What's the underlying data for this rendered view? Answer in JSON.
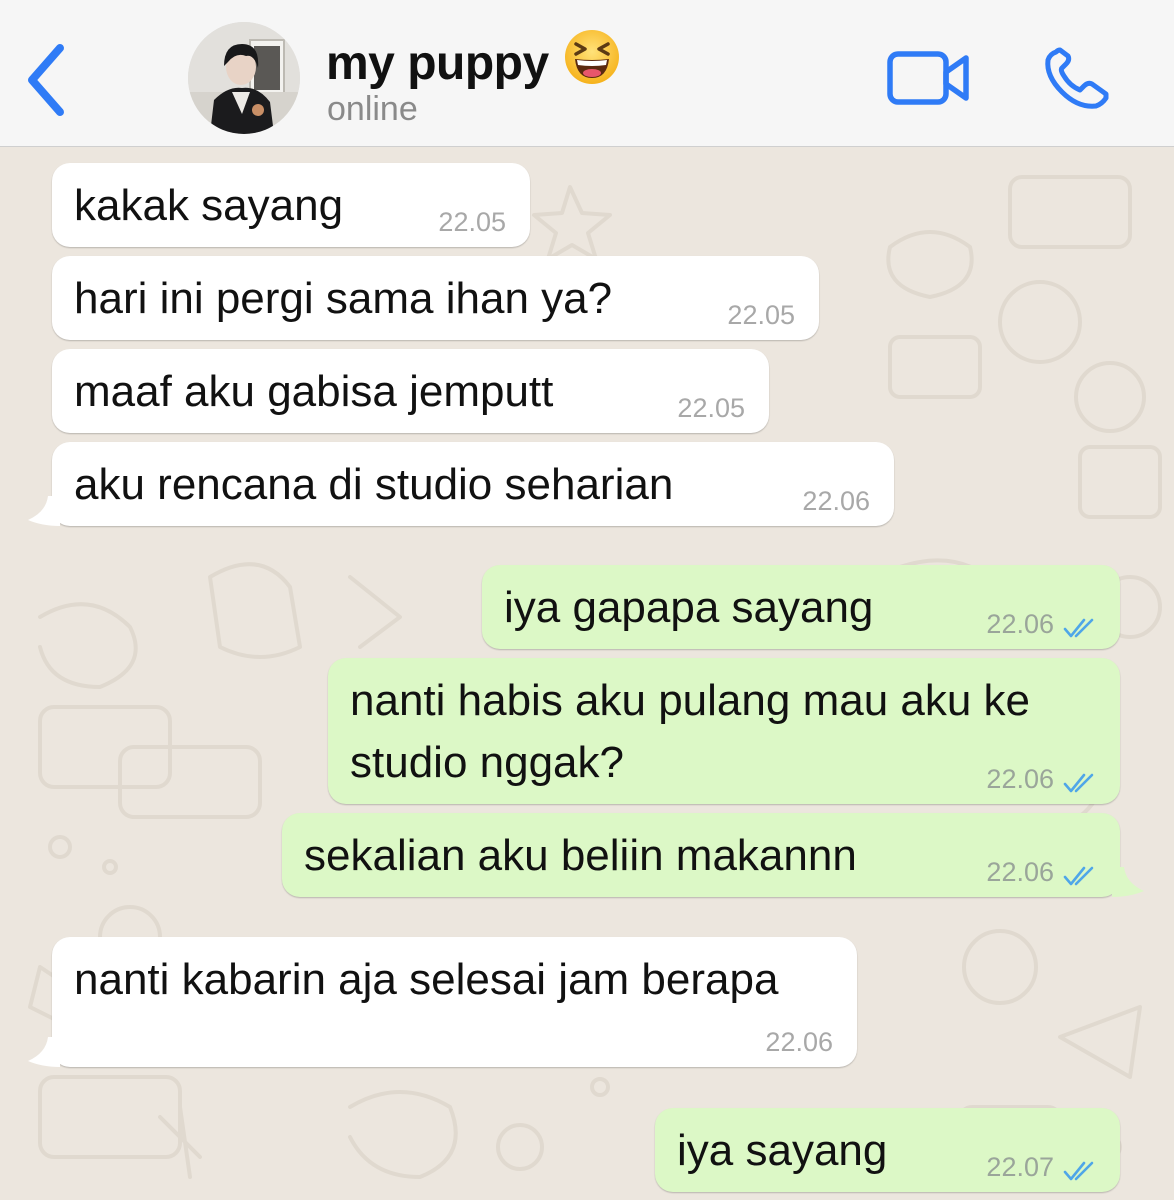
{
  "header": {
    "back_icon": "chevron-left-icon",
    "contact_name": "my puppy",
    "name_emoji": "😆",
    "status": "online",
    "video_icon": "video-camera-icon",
    "call_icon": "phone-icon",
    "accent_color": "#2f7bf6"
  },
  "messages": [
    {
      "dir": "in",
      "text": "kakak sayang",
      "time": "22.05"
    },
    {
      "dir": "in",
      "text": "hari ini pergi sama ihan ya?",
      "time": "22.05"
    },
    {
      "dir": "in",
      "text": "maaf aku gabisa jemputt",
      "time": "22.05"
    },
    {
      "dir": "in",
      "text": "aku rencana di studio seharian",
      "time": "22.06"
    },
    {
      "dir": "out",
      "text": "iya gapapa sayang",
      "time": "22.06"
    },
    {
      "dir": "out",
      "text": "nanti habis aku pulang mau aku ke\nstudio nggak?",
      "time": "22.06"
    },
    {
      "dir": "out",
      "text": "sekalian aku beliin makannn",
      "time": "22.06"
    },
    {
      "dir": "in",
      "text": "nanti kabarin aja selesai jam berapa",
      "time": "22.06"
    },
    {
      "dir": "out",
      "text": "iya sayang",
      "time": "22.07"
    }
  ],
  "colors": {
    "incoming_bubble": "#ffffff",
    "outgoing_bubble": "#dcf8c6",
    "read_tick": "#4fa6e8",
    "wallpaper": "#ece6de"
  }
}
